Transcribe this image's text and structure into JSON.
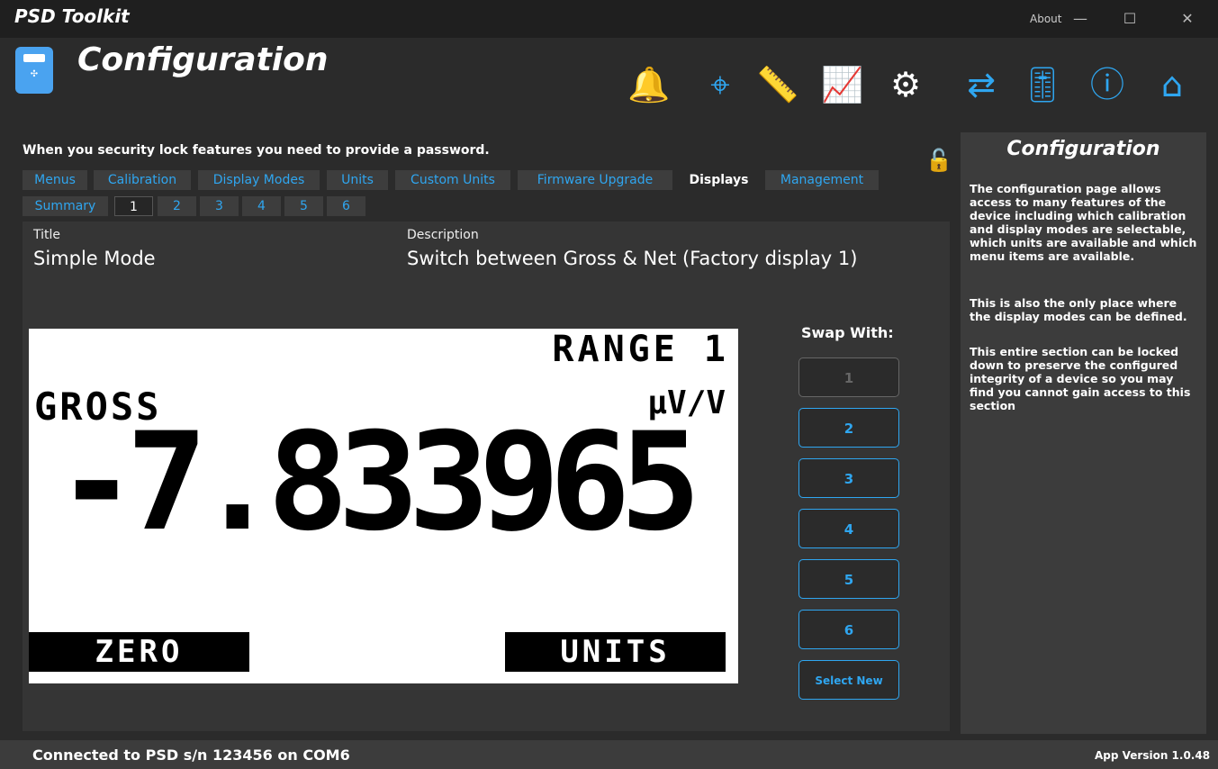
{
  "window": {
    "title": "PSD Toolkit",
    "about": "About"
  },
  "header": {
    "heading": "Configuration",
    "nav": [
      {
        "icon": "alarm-icon",
        "glyph": "🔔"
      },
      {
        "icon": "target-icon",
        "glyph": "⌖"
      },
      {
        "icon": "ruler-icon",
        "glyph": "📏"
      },
      {
        "icon": "chart-icon",
        "glyph": "📈"
      },
      {
        "icon": "settings-icon",
        "glyph": "⚙"
      },
      {
        "icon": "file-transfer-icon",
        "glyph": "⇄"
      },
      {
        "icon": "sliders-icon",
        "glyph": "🎚"
      },
      {
        "icon": "info-icon",
        "glyph": "ⓘ"
      },
      {
        "icon": "home-icon",
        "glyph": "⌂"
      }
    ]
  },
  "main": {
    "lock_message": "When you security lock features you need to provide a password.",
    "tabs": [
      {
        "label": "Menus"
      },
      {
        "label": "Calibration"
      },
      {
        "label": "Display Modes"
      },
      {
        "label": "Units"
      },
      {
        "label": "Custom Units"
      },
      {
        "label": "Firmware Upgrade"
      },
      {
        "label": "Displays"
      },
      {
        "label": "Management"
      }
    ],
    "subtabs": [
      {
        "label": "Summary"
      },
      {
        "label": "1"
      },
      {
        "label": "2"
      },
      {
        "label": "3"
      },
      {
        "label": "4"
      },
      {
        "label": "5"
      },
      {
        "label": "6"
      }
    ],
    "title_label": "Title",
    "title_value": "Simple Mode",
    "description_label": "Description",
    "description_value": "Switch between Gross & Net (Factory display 1)",
    "lcd": {
      "range": "RANGE 1",
      "mode": "GROSS",
      "units": "µV/V",
      "reading": "-7.833965",
      "left_button": "ZERO",
      "right_button": "UNITS"
    },
    "swap_title": "Swap With:",
    "swap_buttons": [
      "1",
      "2",
      "3",
      "4",
      "5",
      "6",
      "Select New"
    ]
  },
  "info": {
    "title": "Configuration",
    "paragraphs": [
      "The configuration page allows access to many features of the device including which calibration and display modes are selectable, which units are available and which menu items are available.",
      "This is also the only place where the display modes can be defined.",
      "This entire section can be locked down to preserve the configured integrity of a device so you may find you cannot gain access to this section"
    ]
  },
  "status": {
    "connection": "Connected to PSD s/n 123456 on COM6",
    "version": "App Version 1.0.48"
  },
  "colors": {
    "accent": "#2fa6f0",
    "background": "#2b2b2b",
    "panel": "#3c3c3c"
  }
}
